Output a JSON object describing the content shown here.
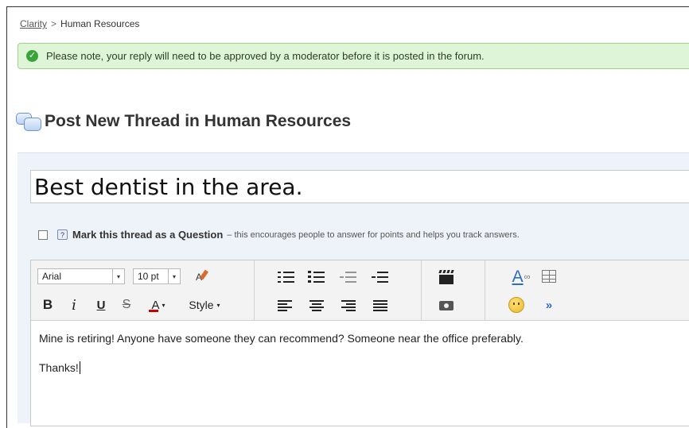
{
  "breadcrumb": {
    "root": "Clarity",
    "separator": ">",
    "current": "Human Resources"
  },
  "notice": {
    "text": "Please note, your reply will need to be approved by a moderator before it is posted in the forum."
  },
  "page": {
    "title": "Post New Thread in Human Resources"
  },
  "subject": {
    "value": "Best dentist in the area."
  },
  "question_option": {
    "checked": false,
    "help_icon": "?",
    "label": "Mark this thread as a Question",
    "description": "– this encourages people to answer for points and helps you track answers."
  },
  "toolbar": {
    "font": "Arial",
    "size": "10 pt",
    "dropdown_arrow": "▾",
    "bold": "B",
    "italic": "i",
    "underline": "U",
    "strike": "S",
    "text_color": "A",
    "style": "Style",
    "format_painter": "A",
    "link": "A",
    "more": "»"
  },
  "body": {
    "paragraphs": [
      "Mine is retiring! Anyone have someone they can recommend? Someone near the office preferably.",
      "Thanks!"
    ]
  },
  "colors": {
    "notice_bg": "#dff5d8",
    "notice_border": "#9fd38c",
    "accent": "#2b6cc4",
    "panel_bg": "#eef3f9"
  }
}
